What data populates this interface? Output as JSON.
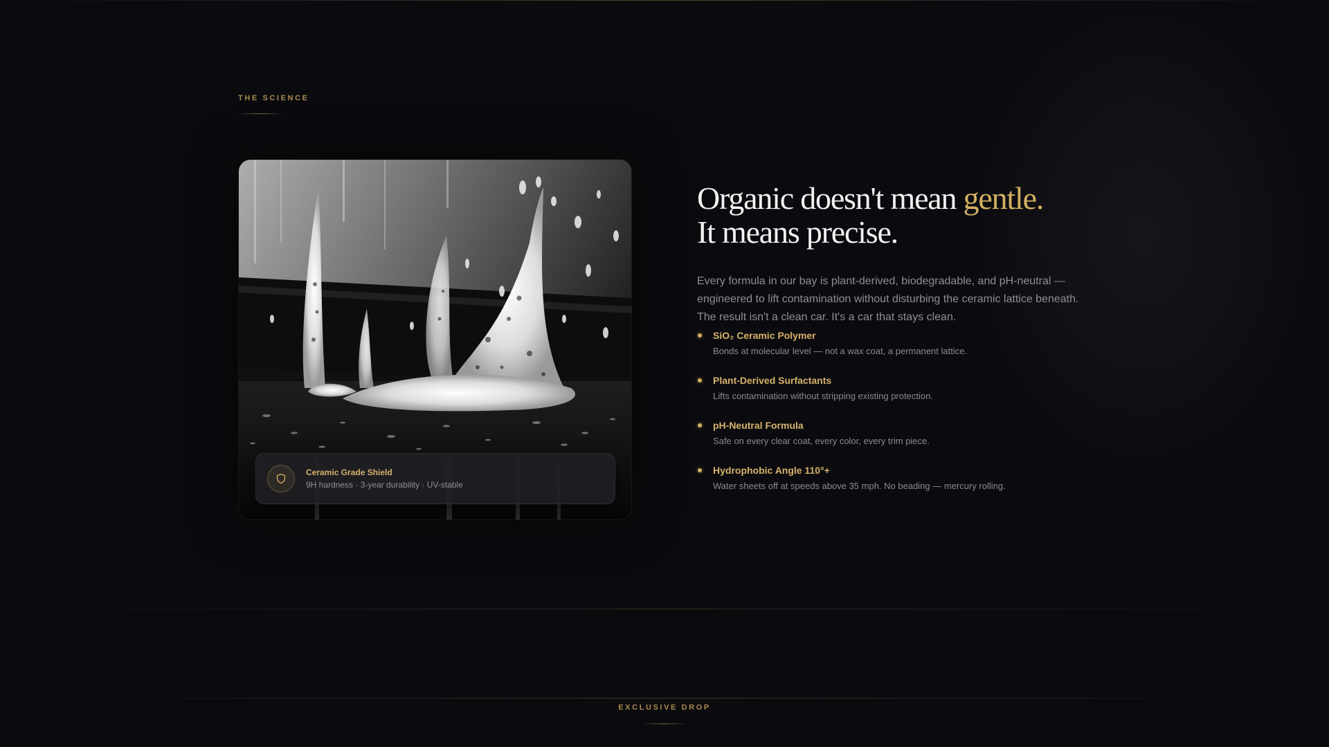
{
  "science_section": {
    "eyebrow": "THE SCIENCE",
    "card": {
      "image_alt": "Foam splash on glossy black surface",
      "badge": {
        "icon": "shield-icon",
        "title": "Ceramic Grade Shield",
        "subtitle": "9H hardness · 3-year durability · UV-stable"
      }
    },
    "headline": {
      "line1_prefix": "Organic doesn't mean ",
      "line1_accent": "gentle.",
      "line2": "It means precise."
    },
    "body": "Every formula in our bay is plant-derived, biodegradable, and pH-neutral — engineered to lift contamination without disturbing the ceramic lattice beneath. The result isn't a clean car. It's a car that stays clean.",
    "features": [
      {
        "title": "SiO₂ Ceramic Polymer",
        "description": "Bonds at molecular level — not a wax coat, a permanent lattice."
      },
      {
        "title": "Plant-Derived Surfactants",
        "description": "Lifts contamination without stripping existing protection."
      },
      {
        "title": "pH-Neutral Formula",
        "description": "Safe on every clear coat, every color, every trim piece."
      },
      {
        "title": "Hydrophobic Angle 110°+",
        "description": "Water sheets off at speeds above 35 mph. No beading — mercury rolling."
      }
    ]
  },
  "next_section": {
    "eyebrow": "EXCLUSIVE DROP"
  },
  "colors": {
    "background": "#0b0b0f",
    "accent_gold": "#d4b062",
    "muted_text": "#8e8e94",
    "headline_text": "#f2f2f2"
  }
}
